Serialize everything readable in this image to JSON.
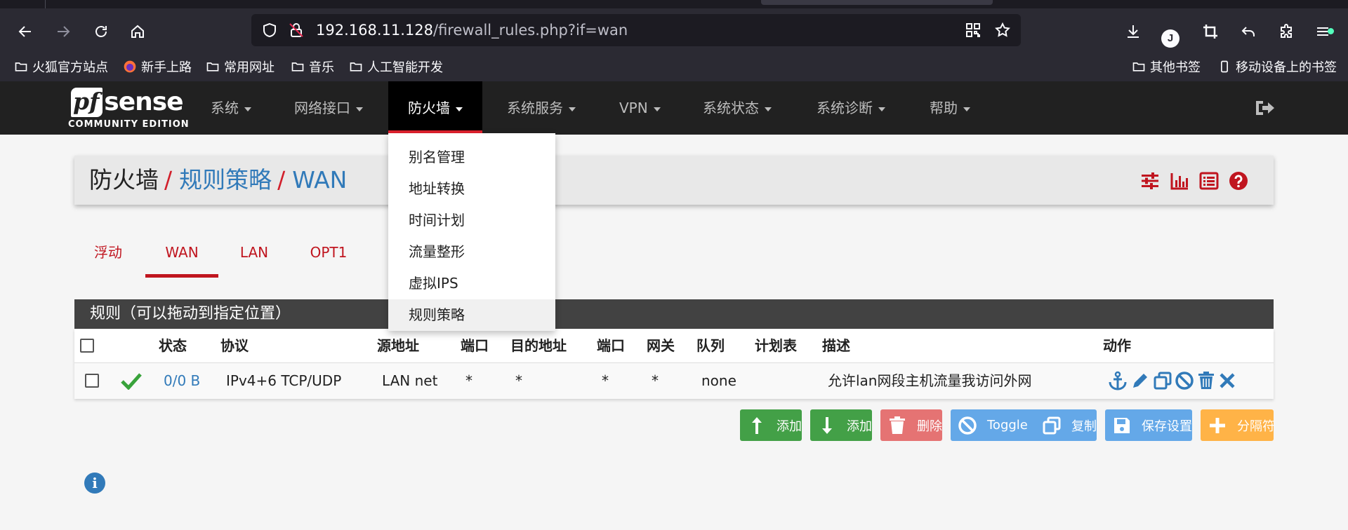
{
  "browser": {
    "url_host": "192.168.11.128",
    "url_path": "/firewall_rules.php?if=wan",
    "profile_initial": "J",
    "bookmarks_left": [
      "火狐官方站点",
      "新手上路",
      "常用网址",
      "音乐",
      "人工智能开发"
    ],
    "bookmarks_right": [
      "其他书签",
      "移动设备上的书签"
    ]
  },
  "brand": {
    "logo_pf": "pf",
    "logo_sense": "sense",
    "edition": "COMMUNITY EDITION"
  },
  "nav": {
    "items": [
      "系统",
      "网络接口",
      "防火墙",
      "系统服务",
      "VPN",
      "系统状态",
      "系统诊断",
      "帮助"
    ],
    "active": "防火墙"
  },
  "dropdown": {
    "items": [
      "别名管理",
      "地址转换",
      "时间计划",
      "流量整形",
      "虚拟IPS",
      "规则策略"
    ],
    "highlighted": "规则策略"
  },
  "breadcrumb": {
    "root": "防火墙",
    "section": "规则策略",
    "current": "WAN",
    "separator": "/"
  },
  "tabs": {
    "items": [
      "浮动",
      "WAN",
      "LAN",
      "OPT1"
    ],
    "active": "WAN"
  },
  "rules": {
    "heading": "规则（可以拖动到指定位置）",
    "columns": [
      "状态",
      "协议",
      "源地址",
      "端口",
      "目的地址",
      "端口",
      "网关",
      "队列",
      "计划表",
      "描述",
      "动作"
    ],
    "rows": [
      {
        "states": "0/0 B",
        "protocol": "IPv4+6 TCP/UDP",
        "source": "LAN net",
        "src_port": "*",
        "destination": "*",
        "dst_port": "*",
        "gateway": "*",
        "queue": "none",
        "schedule": "",
        "description": "允许lan网段主机流量我访问外网"
      }
    ]
  },
  "buttons": {
    "add_top": "添加",
    "add_bottom": "添加",
    "delete": "删除",
    "toggle": "Toggle",
    "copy": "复制",
    "save": "保存设置",
    "separator": "分隔符"
  },
  "colors": {
    "nav_bg": "#212121",
    "accent_red": "#c0151f",
    "link_blue": "#317ab9",
    "green": "#43a047",
    "orange": "#ffb347"
  }
}
